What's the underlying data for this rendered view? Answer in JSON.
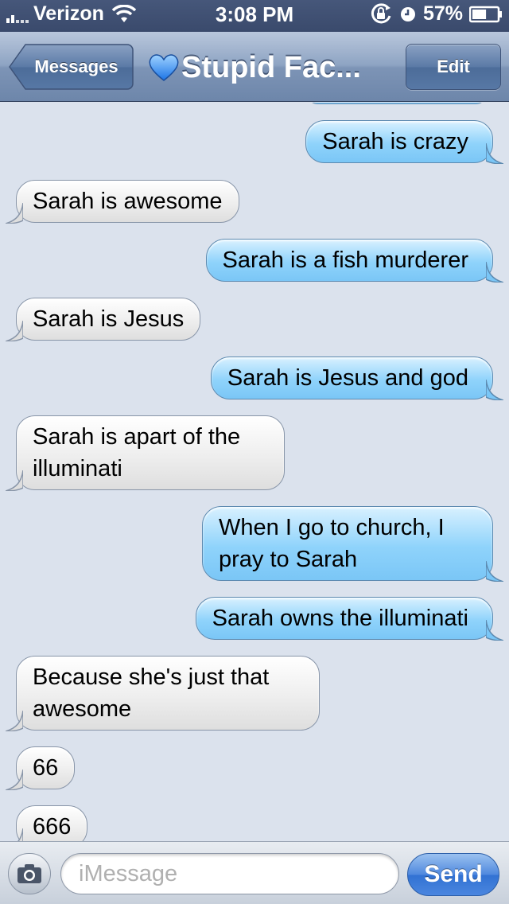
{
  "status_bar": {
    "carrier": "Verizon",
    "time": "3:08 PM",
    "battery_percent": "57%",
    "battery_level": 0.57,
    "icons": [
      "signal-icon",
      "wifi-icon",
      "rotation-lock-icon",
      "alarm-icon",
      "battery-icon"
    ]
  },
  "nav": {
    "back_label": "Messages",
    "title": "Stupid Fac...",
    "title_icon": "blue-heart-icon",
    "edit_label": "Edit"
  },
  "messages": [
    {
      "type": "sent",
      "text": "Sarah is crazy"
    },
    {
      "type": "recv",
      "text": "Sarah is awesome"
    },
    {
      "type": "sent",
      "text": "Sarah is a fish murderer"
    },
    {
      "type": "recv",
      "text": "Sarah is Jesus"
    },
    {
      "type": "sent",
      "text": "Sarah is Jesus and god"
    },
    {
      "type": "recv",
      "text": "Sarah is apart of the illuminati"
    },
    {
      "type": "sent",
      "text": "When I go to church, I pray to Sarah"
    },
    {
      "type": "sent",
      "text": "Sarah owns the illuminati"
    },
    {
      "type": "recv",
      "text": "Because she's just that awesome"
    },
    {
      "type": "recv",
      "text": "66"
    },
    {
      "type": "recv",
      "text": "666"
    }
  ],
  "composer": {
    "placeholder": "iMessage",
    "value": "",
    "send_label": "Send",
    "camera_icon": "camera-icon"
  },
  "colors": {
    "sent_bubble": "#8fd3fb",
    "recv_bubble": "#eeeeee",
    "background": "#dbe2ed",
    "send_button": "#3272d3"
  }
}
